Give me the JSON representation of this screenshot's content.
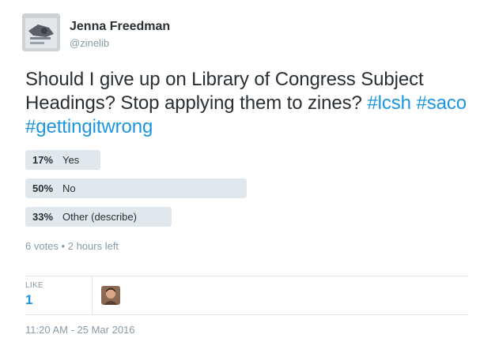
{
  "author": {
    "name": "Jenna Freedman",
    "handle": "@zinelib"
  },
  "tweet": {
    "text": "Should I give up on Library of Congress Subject Headings? Stop applying them to zines? ",
    "hashtags": [
      "#lcsh",
      "#saco",
      "#gettingitwrong"
    ]
  },
  "poll": {
    "options": [
      {
        "percent": "17%",
        "label": "Yes",
        "share": 0.17
      },
      {
        "percent": "50%",
        "label": "No",
        "share": 0.5
      },
      {
        "percent": "33%",
        "label": "Other (describe)",
        "share": 0.33
      }
    ],
    "votes": "6 votes",
    "separator": "•",
    "time_left": "2 hours left"
  },
  "stats": {
    "like_label": "LIKE",
    "like_count": "1"
  },
  "timestamp": "11:20 AM - 25 Mar 2016",
  "colors": {
    "link": "#1b95e0",
    "poll_bar": "#e1e8ed",
    "muted": "#8899a6",
    "text": "#292f33"
  }
}
